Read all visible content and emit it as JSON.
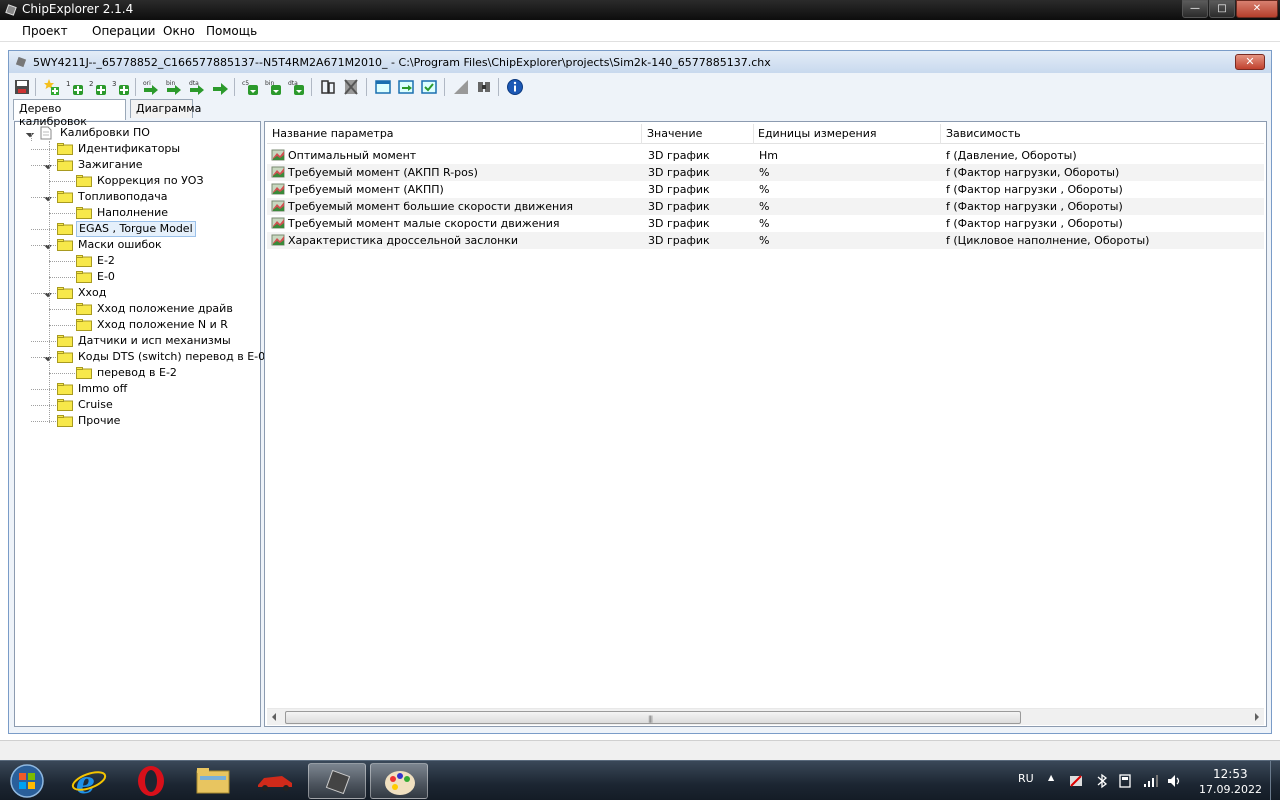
{
  "app": {
    "title": "ChipExplorer 2.1.4"
  },
  "menu": [
    "Проект",
    "Операции",
    "Окно",
    "Помощь"
  ],
  "mdi": {
    "title": "5WY4211J--_65778852_C166577885137--N5T4RM2A671M2010_ - C:\\Program Files\\ChipExplorer\\projects\\Sim2k-140_6577885137.chx"
  },
  "toolbar": {
    "labels": {
      "ori1": "ori",
      "bin1": "bin",
      "dta1": "dta",
      "c5": "c5",
      "bin2": "bin",
      "dta2": "dta",
      "n1": "1",
      "n2": "2",
      "n3": "3"
    }
  },
  "tabs": [
    "Дерево калибровок",
    "Диаграмма"
  ],
  "tree": [
    {
      "label": "Калибровки ПО",
      "level": 0,
      "expanded": true,
      "icon": "document-icon"
    },
    {
      "label": "Идентификаторы",
      "level": 1
    },
    {
      "label": "Зажигание",
      "level": 1,
      "expanded": true
    },
    {
      "label": "Коррекция по УОЗ",
      "level": 2
    },
    {
      "label": "Топливоподача",
      "level": 1,
      "expanded": true
    },
    {
      "label": "Наполнение",
      "level": 2
    },
    {
      "label": "EGAS , Torgue Model",
      "level": 1,
      "selected": true
    },
    {
      "label": "Маски ошибок",
      "level": 1,
      "expanded": true
    },
    {
      "label": "E-2",
      "level": 2
    },
    {
      "label": "E-0",
      "level": 2
    },
    {
      "label": "Xxод",
      "level": 1,
      "expanded": true
    },
    {
      "label": "Xxод положение драйв",
      "level": 2
    },
    {
      "label": "Xxод положение N и R",
      "level": 2
    },
    {
      "label": "Датчики и исп механизмы",
      "level": 1
    },
    {
      "label": "Коды DTS (switch) перевод в E-0",
      "level": 1,
      "expanded": true
    },
    {
      "label": "перевод в E-2",
      "level": 2
    },
    {
      "label": "Immo off",
      "level": 1
    },
    {
      "label": "Cruise",
      "level": 1
    },
    {
      "label": "Прочие",
      "level": 1
    }
  ],
  "table": {
    "columns": [
      "Название параметра",
      "Значение",
      "Единицы измерения",
      "Зависимость"
    ],
    "rows": [
      [
        "Оптимальный момент",
        "3D график",
        "Нm",
        "f (Давление, Обороты)"
      ],
      [
        "Требуемый момент (АКПП R-pos)",
        "3D график",
        "%",
        "f (Фактор нагрузки, Обороты)"
      ],
      [
        "Требуемый момент (АКПП)",
        "3D график",
        "%",
        "f (Фактор нагрузки , Обороты)"
      ],
      [
        "Требуемый момент большие скорости движения",
        "3D график",
        "%",
        "f (Фактор нагрузки , Обороты)"
      ],
      [
        "Требуемый момент малые скорости движения",
        "3D график",
        "%",
        "f (Фактор нагрузки , Обороты)"
      ],
      [
        "Характеристика дроссельной заслонки",
        "3D график",
        "%",
        "f (Цикловое наполнение, Обороты)"
      ]
    ]
  },
  "taskbar": {
    "lang": "RU",
    "time": "12:53",
    "date": "17.09.2022"
  },
  "colors": {
    "selection": "#e5f0fb",
    "folder": "#f7e84a",
    "taskbar": "#1c2632"
  }
}
